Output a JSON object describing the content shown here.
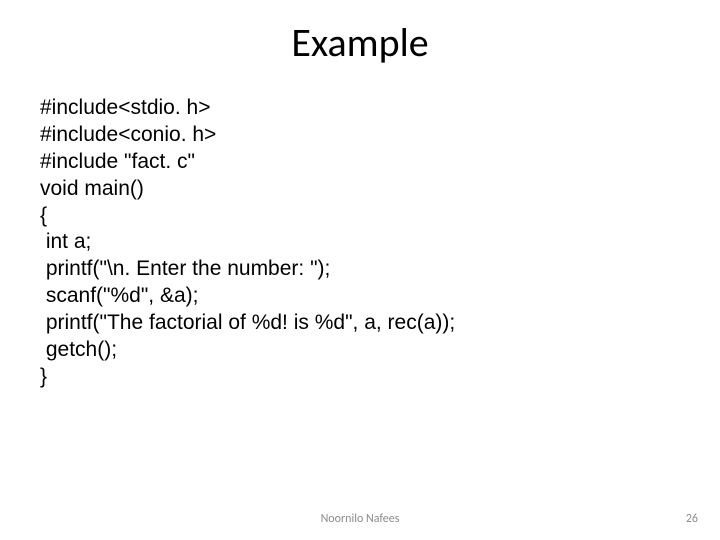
{
  "title": "Example",
  "code_lines": [
    "#include<stdio. h>",
    "#include<conio. h>",
    "#include \"fact. c\"",
    "void main()",
    "{",
    " int a;",
    " printf(\"\\n. Enter the number: \");",
    " scanf(\"%d\", &a);",
    " printf(\"The factorial of %d! is %d\", a, rec(a));",
    " getch();",
    "}"
  ],
  "footer": {
    "author": "Noornilo Nafees",
    "page": "26"
  }
}
